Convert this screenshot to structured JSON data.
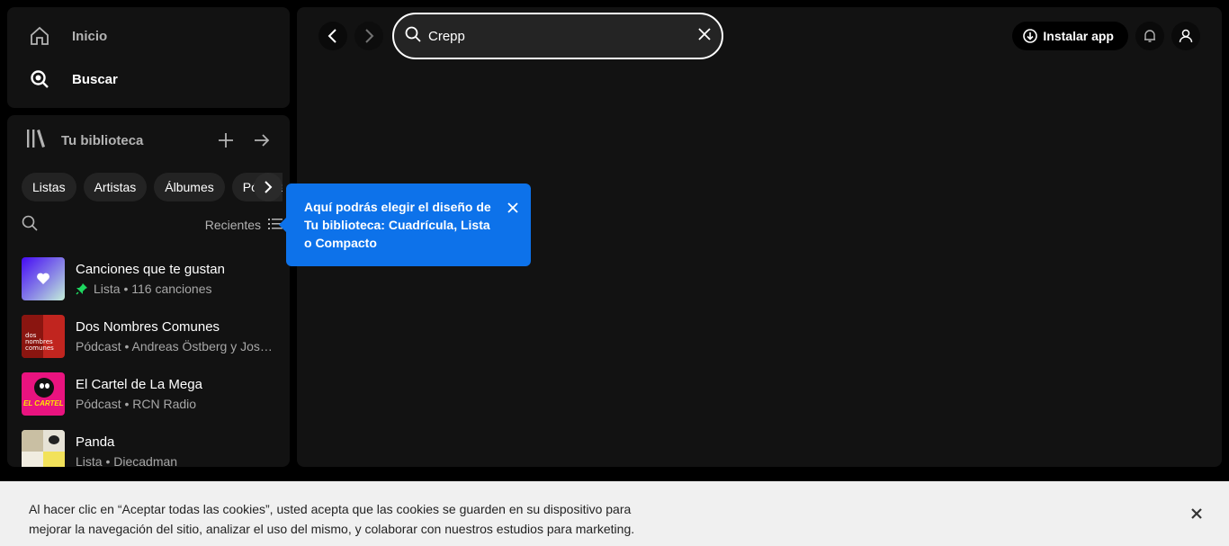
{
  "nav": {
    "home_label": "Inicio",
    "search_label": "Buscar"
  },
  "library": {
    "title": "Tu biblioteca",
    "chips": [
      "Listas",
      "Artistas",
      "Álbumes",
      "Pódcasts"
    ],
    "sort_label": "Recientes",
    "items": [
      {
        "title": "Canciones que te gustan",
        "subtitle": "Lista • 116 canciones",
        "pinned": true
      },
      {
        "title": "Dos Nombres Comunes",
        "subtitle": "Pódcast • Andreas Östberg y Jos…",
        "cover_text": "dos nombres comunes"
      },
      {
        "title": "El Cartel de La Mega",
        "subtitle": "Pódcast • RCN Radio",
        "cover_text": "EL CARTEL"
      },
      {
        "title": "Panda",
        "subtitle": "Lista • Diecadman"
      }
    ]
  },
  "search": {
    "query": "Crepp"
  },
  "topbar": {
    "install_label": "Instalar app"
  },
  "tooltip": {
    "text": "Aquí podrás elegir el diseño de Tu biblioteca: Cuadrícula, Lista o Compacto"
  },
  "cookie": {
    "text": "Al hacer clic en “Aceptar todas las cookies”, usted acepta que las cookies se guarden en su dispositivo para mejorar la navegación del sitio, analizar el uso del mismo, y colaborar con nuestros estudios para marketing."
  },
  "colors": {
    "accent": "#1ed760",
    "tooltip_bg": "#0d72ea",
    "panel_bg": "#121212"
  }
}
